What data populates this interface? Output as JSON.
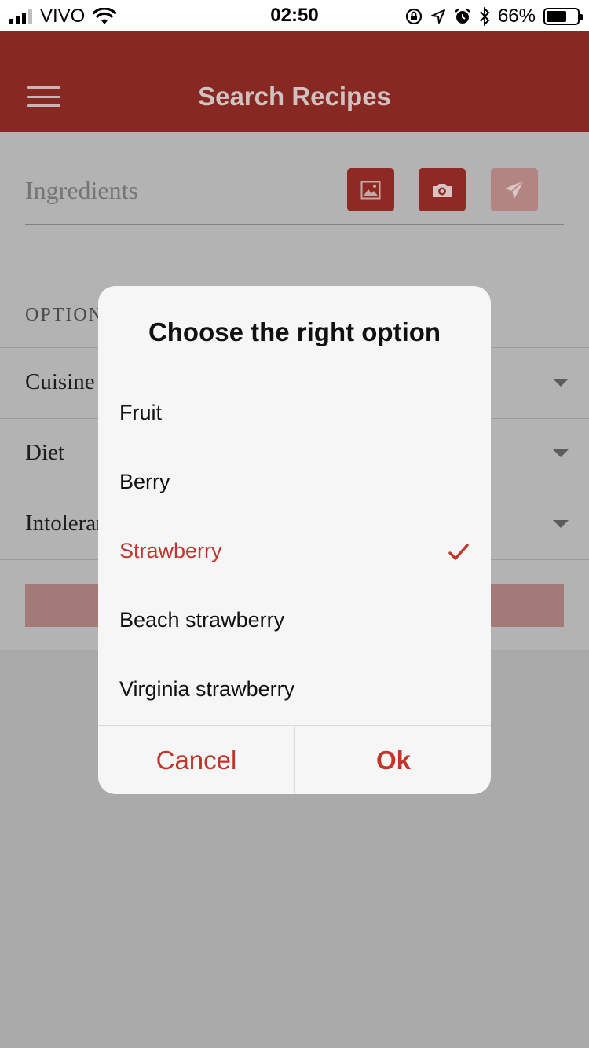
{
  "status_bar": {
    "carrier": "VIVO",
    "time": "02:50",
    "battery_percent": "66%",
    "battery_level": 0.66,
    "icons": [
      "signal-icon",
      "wifi-icon",
      "orientation-lock-icon",
      "location-icon",
      "alarm-icon",
      "bluetooth-icon",
      "battery-icon"
    ]
  },
  "header": {
    "title": "Search Recipes",
    "menu_icon": "hamburger-menu-icon"
  },
  "search": {
    "placeholder": "Ingredients",
    "buttons": [
      {
        "name": "gallery-button",
        "icon": "image-icon",
        "enabled": true
      },
      {
        "name": "camera-button",
        "icon": "camera-icon",
        "enabled": true
      },
      {
        "name": "send-button",
        "icon": "paper-plane-icon",
        "enabled": false
      }
    ]
  },
  "options": {
    "section_label": "OPTION",
    "rows": [
      {
        "label": "Cuisine"
      },
      {
        "label": "Diet"
      },
      {
        "label": "Intoleran"
      }
    ]
  },
  "modal": {
    "title": "Choose the right option",
    "options": [
      {
        "label": "Fruit",
        "selected": false
      },
      {
        "label": "Berry",
        "selected": false
      },
      {
        "label": "Strawberry",
        "selected": true
      },
      {
        "label": "Beach strawberry",
        "selected": false
      },
      {
        "label": "Virginia strawberry",
        "selected": false
      }
    ],
    "cancel_label": "Cancel",
    "ok_label": "Ok"
  },
  "colors": {
    "header_bg": "#882822",
    "accent": "#c0362c",
    "overlay": "#aaaaaa",
    "modal_bg": "#f6f6f6"
  }
}
